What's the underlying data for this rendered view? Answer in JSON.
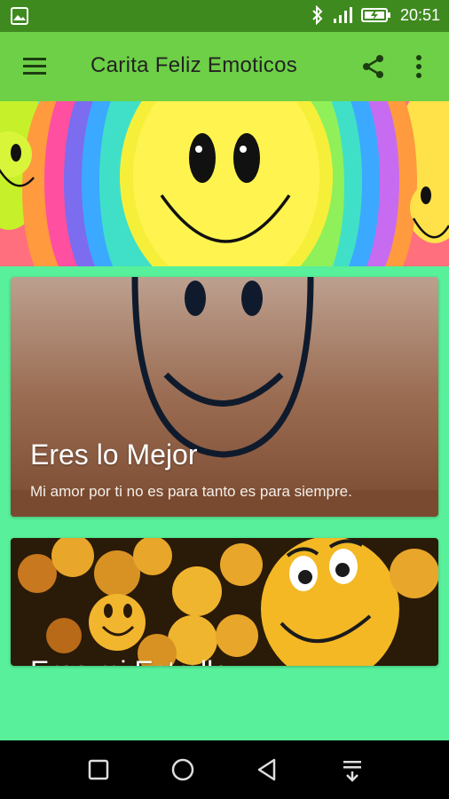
{
  "status_bar": {
    "time": "20:51",
    "icons": [
      "gallery-icon",
      "bluetooth-icon",
      "signal-icon",
      "battery-charging-icon"
    ]
  },
  "app_bar": {
    "title": "Carita Feliz Emoticos",
    "icons": [
      "menu-icon",
      "share-icon",
      "more-vert-icon"
    ]
  },
  "cards": [
    {
      "title": "Eres lo Mejor",
      "subtitle": "Mi amor por ti no es para tanto es para siempre."
    },
    {
      "title": "Eres mi Estrella"
    }
  ],
  "nav_bar": {
    "icons": [
      "recent-apps-icon",
      "home-icon",
      "back-icon",
      "notification-pull-icon"
    ]
  },
  "colors": {
    "status_bar": "#3f8a1f",
    "app_bar": "#6dd046",
    "background": "#58f09a",
    "card1_bg": "#a86a4c",
    "nav_bar": "#000000"
  }
}
